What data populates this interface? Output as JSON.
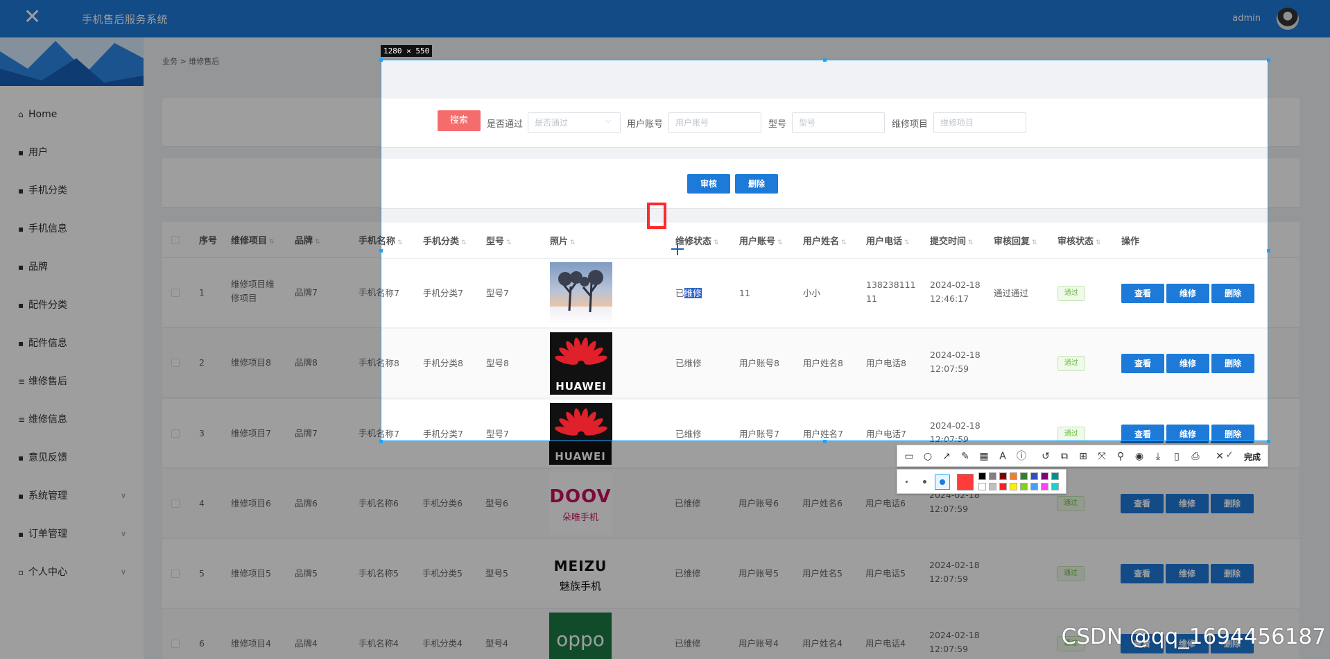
{
  "header": {
    "app_title": "手机售后服务系统",
    "user": "admin"
  },
  "sidebar": {
    "items": [
      {
        "label": "Home",
        "icon": "home-icon",
        "glyph": "⌂"
      },
      {
        "label": "用户",
        "icon": "grid-icon",
        "glyph": "▪"
      },
      {
        "label": "手机分类",
        "icon": "pin-icon",
        "glyph": "▪"
      },
      {
        "label": "手机信息",
        "icon": "grid-icon",
        "glyph": "▪"
      },
      {
        "label": "品牌",
        "icon": "grid-icon",
        "glyph": "▪"
      },
      {
        "label": "配件分类",
        "icon": "grid-icon",
        "glyph": "▪"
      },
      {
        "label": "配件信息",
        "icon": "chat-icon",
        "glyph": "▪"
      },
      {
        "label": "维修售后",
        "icon": "list-icon",
        "glyph": "≡"
      },
      {
        "label": "维修信息",
        "icon": "list-icon",
        "glyph": "≡"
      },
      {
        "label": "意见反馈",
        "icon": "grid-icon",
        "glyph": "▪"
      },
      {
        "label": "系统管理",
        "icon": "briefcase-icon",
        "glyph": "▪"
      },
      {
        "label": "订单管理",
        "icon": "clipboard-icon",
        "glyph": "▪"
      },
      {
        "label": "个人中心",
        "icon": "id-card-icon",
        "glyph": "▫"
      }
    ]
  },
  "breadcrumb": "业务 > 维修售后",
  "search": {
    "button": "搜索",
    "label_pass": "是否通过",
    "pass_placeholder": "是否通过",
    "label_account": "用户账号",
    "account_placeholder": "用户账号",
    "label_model": "型号",
    "model_placeholder": "型号",
    "label_item": "维修项目",
    "item_placeholder": "维修项目"
  },
  "actions": {
    "audit": "审核",
    "delete": "删除"
  },
  "table": {
    "columns": [
      "序号",
      "维修项目",
      "品牌",
      "手机名称",
      "手机分类",
      "型号",
      "照片",
      "维修状态",
      "用户账号",
      "用户姓名",
      "用户电话",
      "提交时间",
      "审核回复",
      "审核状态",
      "操作"
    ],
    "row_actions": {
      "view": "查看",
      "repair": "维修",
      "delete": "删除"
    },
    "rows": [
      {
        "idx": "1",
        "item_l1": "维修项目维",
        "item_l2": "修项目",
        "brand": "品牌7",
        "name": "手机名称7",
        "cat": "手机分类7",
        "model": "型号7",
        "photo": "snowy-tree-photo",
        "status_a": "已",
        "status_b": "维修",
        "account": "11",
        "uname": "小小",
        "phone_l1": "138238111",
        "phone_l2": "11",
        "date": "2024-02-18",
        "time": "12:46:17",
        "reply": "通过通过",
        "audit": "通过"
      },
      {
        "idx": "2",
        "item_l1": "维修项目8",
        "item_l2": "",
        "brand": "品牌8",
        "name": "手机名称8",
        "cat": "手机分类8",
        "model": "型号8",
        "photo": "huawei-logo",
        "status_a": "已维修",
        "status_b": "",
        "account": "用户账号8",
        "uname": "用户姓名8",
        "phone_l1": "用户电话8",
        "phone_l2": "",
        "date": "2024-02-18",
        "time": "12:07:59",
        "reply": "",
        "audit": "通过"
      },
      {
        "idx": "3",
        "item_l1": "维修项目7",
        "item_l2": "",
        "brand": "品牌7",
        "name": "手机名称7",
        "cat": "手机分类7",
        "model": "型号7",
        "photo": "huawei-logo",
        "status_a": "已维修",
        "status_b": "",
        "account": "用户账号7",
        "uname": "用户姓名7",
        "phone_l1": "用户电话7",
        "phone_l2": "",
        "date": "2024-02-18",
        "time": "12:07:59",
        "reply": "",
        "audit": "通过"
      },
      {
        "idx": "4",
        "item_l1": "维修项目6",
        "item_l2": "",
        "brand": "品牌6",
        "name": "手机名称6",
        "cat": "手机分类6",
        "model": "型号6",
        "photo": "doov-logo",
        "status_a": "已维修",
        "status_b": "",
        "account": "用户账号6",
        "uname": "用户姓名6",
        "phone_l1": "用户电话6",
        "phone_l2": "",
        "date": "2024-02-18",
        "time": "12:07:59",
        "reply": "",
        "audit": "通过"
      },
      {
        "idx": "5",
        "item_l1": "维修项目5",
        "item_l2": "",
        "brand": "品牌5",
        "name": "手机名称5",
        "cat": "手机分类5",
        "model": "型号5",
        "photo": "meizu-logo",
        "status_a": "已维修",
        "status_b": "",
        "account": "用户账号5",
        "uname": "用户姓名5",
        "phone_l1": "用户电话5",
        "phone_l2": "",
        "date": "2024-02-18",
        "time": "12:07:59",
        "reply": "",
        "audit": "通过"
      },
      {
        "idx": "6",
        "item_l1": "维修项目4",
        "item_l2": "",
        "brand": "品牌4",
        "name": "手机名称4",
        "cat": "手机分类4",
        "model": "型号4",
        "photo": "oppo-logo",
        "status_a": "已维修",
        "status_b": "",
        "account": "用户账号4",
        "uname": "用户姓名4",
        "phone_l1": "用户电话4",
        "phone_l2": "",
        "date": "2024-02-18",
        "time": "12:07:59",
        "reply": "",
        "audit": "通过"
      }
    ]
  },
  "logos": {
    "huawei": "HUAWEI",
    "doov": "DOOV",
    "doov_sub": "朵唯手机",
    "meizu": "MEIZU",
    "meizu_sub": "魅族手机",
    "oppo": "oppo"
  },
  "capture": {
    "size_label": "1280 × 550",
    "done_label": "完成"
  },
  "palette_colors": [
    "#000000",
    "#808080",
    "#800000",
    "#f08030",
    "#308030",
    "#3050c0",
    "#800080",
    "#009090",
    "#ffffff",
    "#c0c0c0",
    "#ff2020",
    "#ffee00",
    "#80d020",
    "#40a0ff",
    "#ff40ff",
    "#20d0d0"
  ],
  "current_color": "#ff3b3b",
  "watermark": "CSDN @qq_1694456187"
}
